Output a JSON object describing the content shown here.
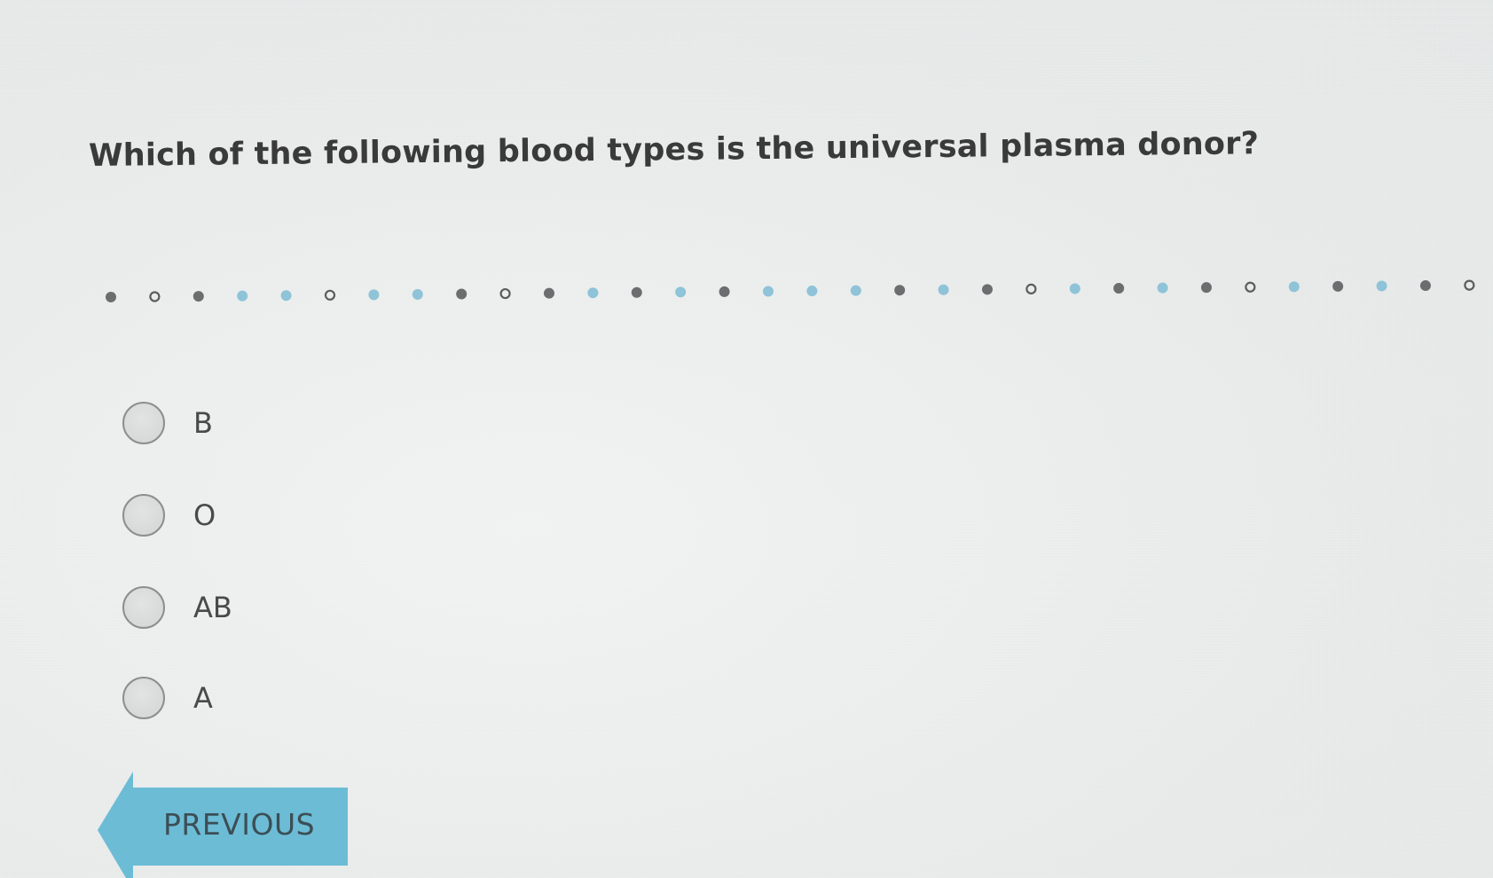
{
  "question": {
    "text": "Which of the following blood types is the universal plasma donor?"
  },
  "progress": {
    "dots": [
      "filled-gray",
      "hollow",
      "filled-gray",
      "filled-blue",
      "filled-blue",
      "hollow",
      "filled-blue",
      "filled-blue",
      "filled-gray",
      "hollow",
      "filled-gray",
      "filled-blue",
      "filled-gray",
      "filled-blue",
      "filled-gray",
      "filled-blue",
      "filled-blue",
      "filled-blue",
      "filled-gray",
      "filled-blue",
      "filled-gray",
      "hollow",
      "filled-blue",
      "filled-gray",
      "filled-blue",
      "filled-gray",
      "hollow",
      "filled-blue",
      "filled-gray",
      "filled-blue",
      "filled-gray",
      "hollow"
    ],
    "colors": {
      "gray": "#6b6e6e",
      "blue": "#8ec3d8",
      "hollow_stroke": "#5a5d5d"
    }
  },
  "options": [
    {
      "label": "B",
      "selected": false
    },
    {
      "label": "O",
      "selected": false
    },
    {
      "label": "AB",
      "selected": false
    },
    {
      "label": "A",
      "selected": false
    }
  ],
  "navigation": {
    "previous_label": "PREVIOUS",
    "previous_color": "#6cbcd6"
  }
}
